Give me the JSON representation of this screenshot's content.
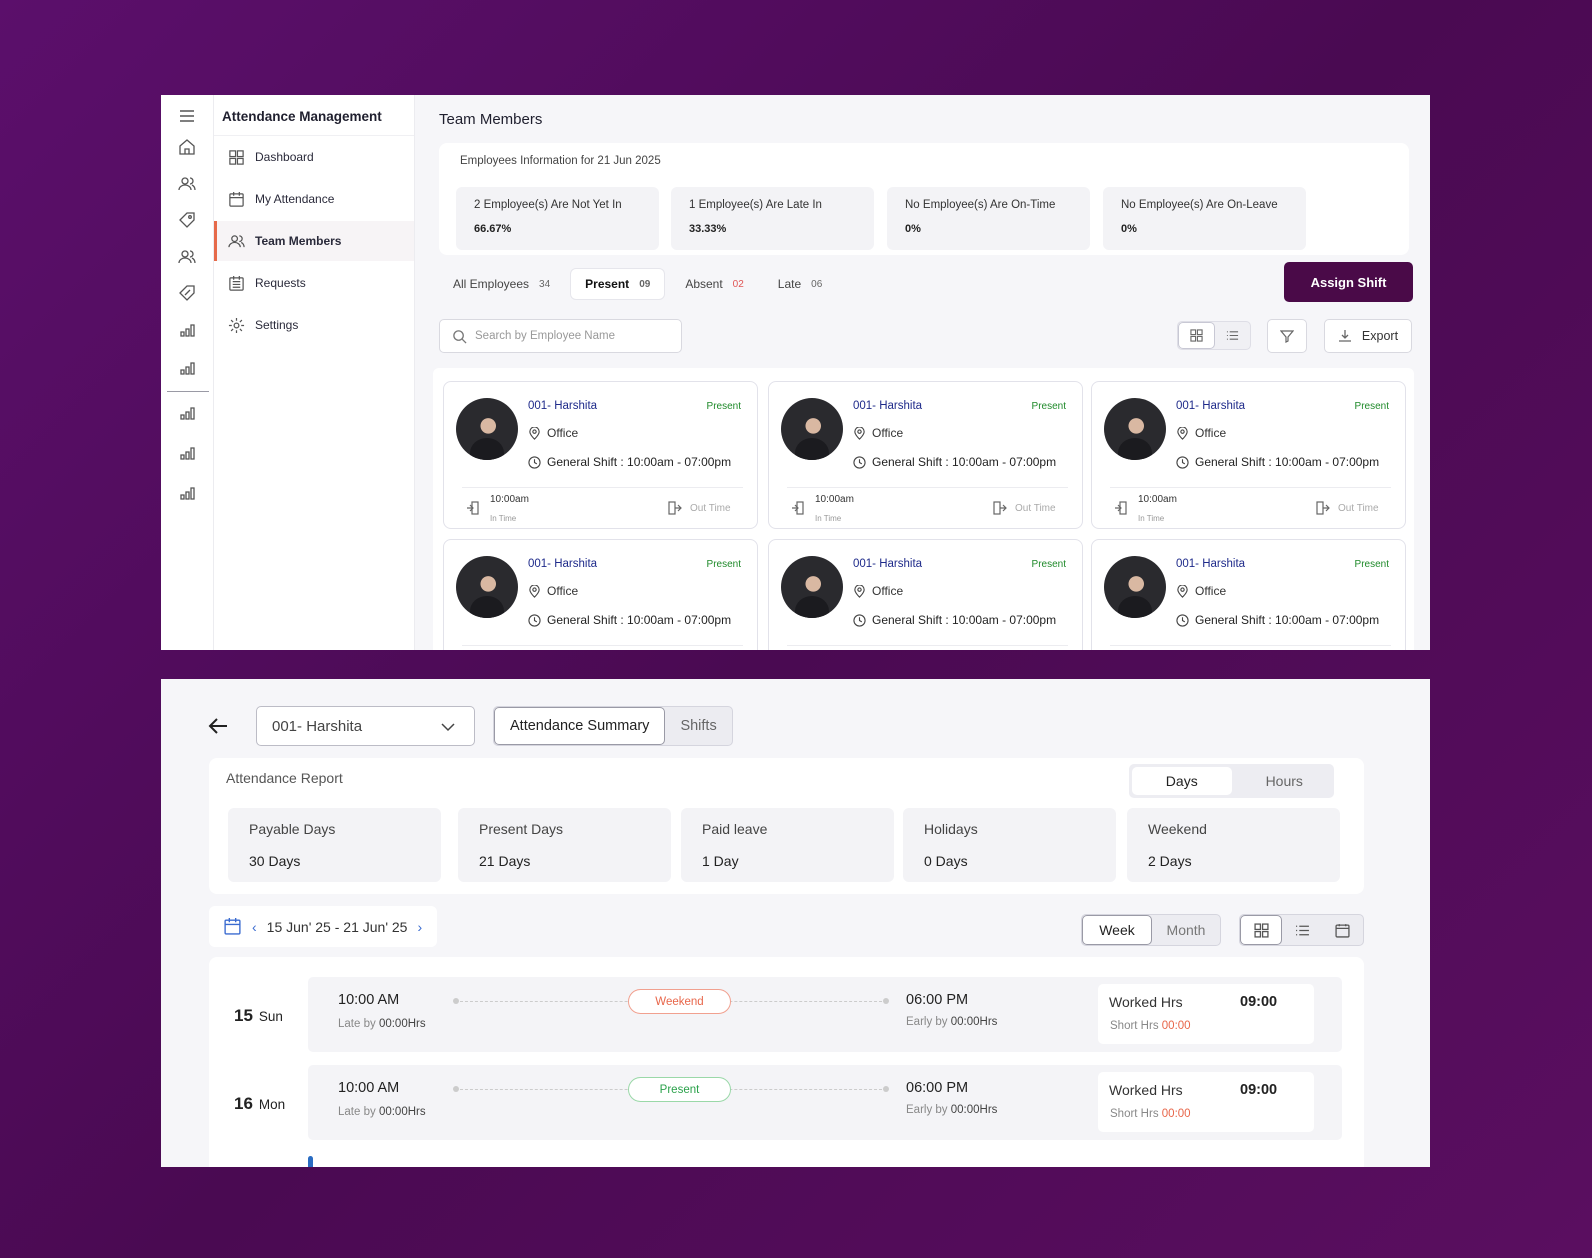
{
  "app": {
    "title": "Attendance Management"
  },
  "sidebar": {
    "items": [
      {
        "label": "Dashboard",
        "icon": "grid-icon"
      },
      {
        "label": "My Attendance",
        "icon": "calendar-icon"
      },
      {
        "label": "Team Members",
        "icon": "users-icon",
        "active": true
      },
      {
        "label": "Requests",
        "icon": "requests-icon"
      },
      {
        "label": "Settings",
        "icon": "gear-icon"
      }
    ]
  },
  "page": {
    "title": "Team Members"
  },
  "info": {
    "label": "Employees Information for 21 Jun 2025",
    "stats": [
      {
        "text": "2 Employee(s) Are Not Yet In",
        "value": "66.67%"
      },
      {
        "text": "1 Employee(s) Are Late In",
        "value": "33.33%"
      },
      {
        "text": "No Employee(s) Are On-Time",
        "value": "0%"
      },
      {
        "text": "No Employee(s) Are On-Leave",
        "value": "0%"
      }
    ]
  },
  "filters": {
    "tabs": [
      {
        "label": "All Employees",
        "count": "34"
      },
      {
        "label": "Present",
        "count": "09",
        "active": true
      },
      {
        "label": "Absent",
        "count": "02"
      },
      {
        "label": "Late",
        "count": "06"
      }
    ],
    "assign_label": "Assign Shift",
    "search_placeholder": "Search by  Employee Name",
    "export_label": "Export"
  },
  "employees": [
    {
      "name": "001- Harshita",
      "status": "Present",
      "location": "Office",
      "shift": "General Shift : 10:00am - 07:00pm",
      "in_time": "10:00am",
      "in_label": "In Time",
      "out_label": "Out Time"
    },
    {
      "name": "001- Harshita",
      "status": "Present",
      "location": "Office",
      "shift": "General Shift : 10:00am - 07:00pm",
      "in_time": "10:00am",
      "in_label": "In Time",
      "out_label": "Out Time"
    },
    {
      "name": "001- Harshita",
      "status": "Present",
      "location": "Office",
      "shift": "General Shift : 10:00am - 07:00pm",
      "in_time": "10:00am",
      "in_label": "In Time",
      "out_label": "Out Time"
    },
    {
      "name": "001- Harshita",
      "status": "Present",
      "location": "Office",
      "shift": "General Shift : 10:00am - 07:00pm"
    },
    {
      "name": "001- Harshita",
      "status": "Present",
      "location": "Office",
      "shift": "General Shift : 10:00am - 07:00pm"
    },
    {
      "name": "001- Harshita",
      "status": "Present",
      "location": "Office",
      "shift": "General Shift : 10:00am - 07:00pm"
    }
  ],
  "detail": {
    "employee": "001- Harshita",
    "tabs": [
      "Attendance Summary",
      "Shifts"
    ],
    "report_label": "Attendance Report",
    "unit_toggle": [
      "Days",
      "Hours"
    ],
    "stats": [
      {
        "label": "Payable Days",
        "value": "30 Days"
      },
      {
        "label": "Present Days",
        "value": "21 Days"
      },
      {
        "label": "Paid leave",
        "value": "1 Day"
      },
      {
        "label": "Holidays",
        "value": "0 Days"
      },
      {
        "label": "Weekend",
        "value": "2 Days"
      }
    ],
    "date_range": "15 Jun' 25 - 21 Jun' 25",
    "period_toggle": [
      "Week",
      "Month"
    ],
    "days": [
      {
        "num": "15",
        "dow": "Sun",
        "in": "10:00 AM",
        "late_lbl": "Late by",
        "late": "00:00Hrs",
        "status": "Weekend",
        "out": "06:00 PM",
        "early_lbl": "Early by",
        "early": "00:00Hrs",
        "worked_lbl": "Worked Hrs",
        "worked": "09:00",
        "short_lbl": "Short Hrs",
        "short": "00:00"
      },
      {
        "num": "16",
        "dow": "Mon",
        "in": "10:00 AM",
        "late_lbl": "Late by",
        "late": "00:00Hrs",
        "status": "Present",
        "out": "06:00 PM",
        "early_lbl": "Early by",
        "early": "00:00Hrs",
        "worked_lbl": "Worked Hrs",
        "worked": "09:00",
        "short_lbl": "Short Hrs",
        "short": "00:00"
      }
    ]
  },
  "colors": {
    "brand": "#4a0a48",
    "accent": "#e66a4a",
    "present": "#1f8a2a",
    "link": "#1e2a8a"
  }
}
